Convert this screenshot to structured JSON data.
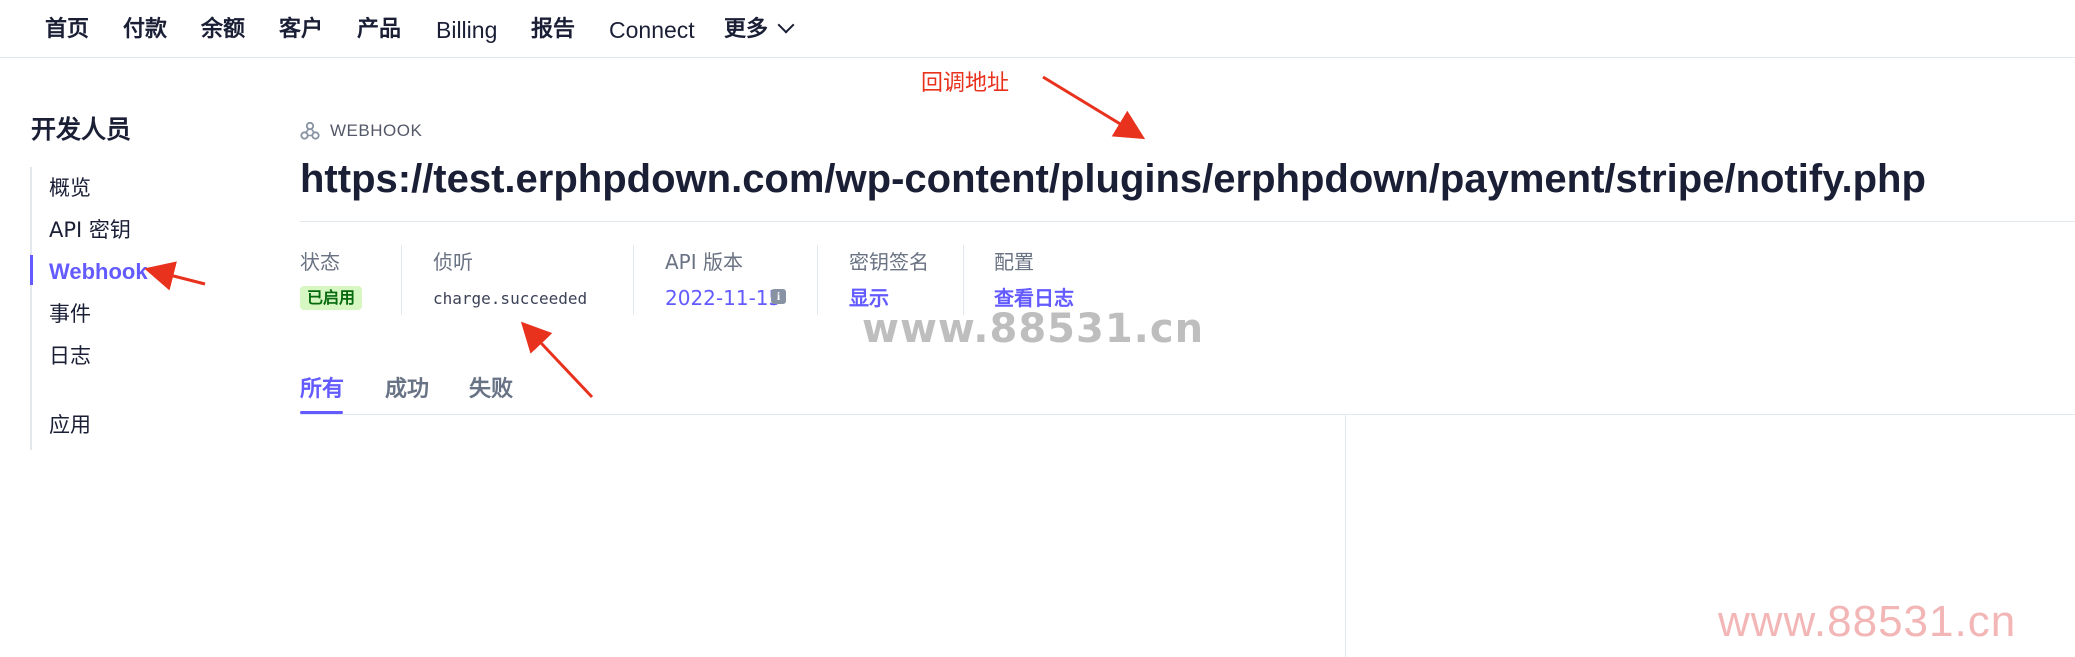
{
  "nav": {
    "items": [
      "首页",
      "付款",
      "余额",
      "客户",
      "产品",
      "Billing",
      "报告",
      "Connect"
    ],
    "more_label": "更多"
  },
  "sidebar": {
    "title": "开发人员",
    "items": [
      {
        "label": "概览"
      },
      {
        "label": "API 密钥"
      },
      {
        "label": "Webhook",
        "active": true
      },
      {
        "label": "事件"
      },
      {
        "label": "日志"
      },
      {
        "label": "应用"
      }
    ],
    "active_color": "#635bff"
  },
  "webhook": {
    "section_label": "WEBHOOK",
    "section_icon": "webhook-icon",
    "url": "https://test.erphpdown.com/wp-content/plugins/erphpdown/payment/stripe/notify.php"
  },
  "fields": {
    "status": {
      "label": "状态",
      "value": "已启用",
      "badge_color": "#d7f7c2"
    },
    "listen": {
      "label": "侦听",
      "value": "charge.succeeded"
    },
    "api_version": {
      "label": "API 版本",
      "value": "2022-11-15",
      "icon": "info-icon"
    },
    "signing_secret": {
      "label": "密钥签名",
      "value": "显示"
    },
    "config": {
      "label": "配置",
      "value": "查看日志"
    }
  },
  "tabs": [
    {
      "label": "所有",
      "active": true
    },
    {
      "label": "成功"
    },
    {
      "label": "失败"
    }
  ],
  "annotations": {
    "callback_label": "回调地址",
    "color": "#e8321e"
  },
  "watermarks": {
    "center": "www.88531.cn",
    "corner": "www.88531.cn"
  }
}
